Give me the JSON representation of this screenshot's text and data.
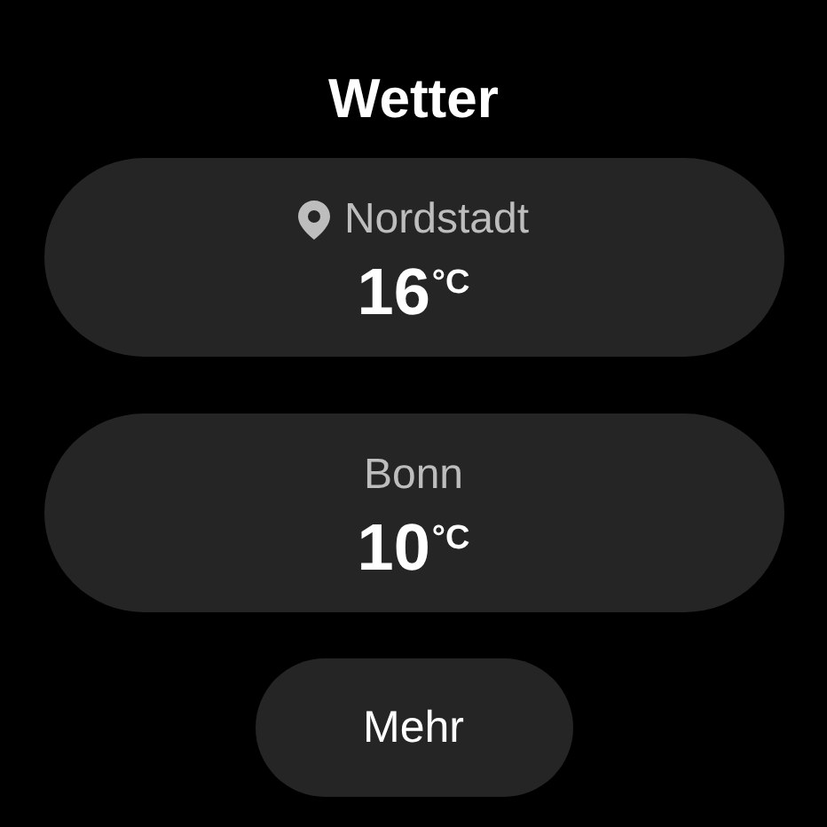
{
  "title": "Wetter",
  "locations": [
    {
      "name": "Nordstadt",
      "current": true,
      "temperature": "16",
      "unit": "°C"
    },
    {
      "name": "Bonn",
      "current": false,
      "temperature": "10",
      "unit": "°C"
    }
  ],
  "button": "Mehr"
}
